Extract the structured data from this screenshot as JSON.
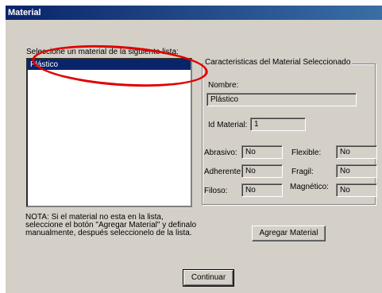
{
  "window": {
    "title": "Material"
  },
  "list": {
    "label": "Seleccione un material de la siguiente lista:",
    "items": [
      "Plástico"
    ],
    "selected": "Plástico"
  },
  "details": {
    "group_title": "Caracteristicas del Material Seleccionado",
    "name_label": "Nombre:",
    "name_value": "Plástico",
    "id_label": "Id Material:",
    "id_value": "1",
    "abrasivo_label": "Abrasivo:",
    "abrasivo_value": "No",
    "flexible_label": "Flexible:",
    "flexible_value": "No",
    "adherente_label": "Adherente:",
    "adherente_value": "No",
    "fragil_label": "Fragil:",
    "fragil_value": "No",
    "filoso_label": "Filoso:",
    "filoso_value": "No",
    "magnetico_label": "Magnético:",
    "magnetico_value": "No"
  },
  "note": {
    "text": "NOTA:    Si el material no esta en la lista, seleccione el botón \"Agregar Material\"  y definalo manualmente, después seleccionelo de la lista."
  },
  "buttons": {
    "add_material": "Agregar Material",
    "continue": "Continuar"
  },
  "annotation": {
    "color": "#e00000"
  }
}
